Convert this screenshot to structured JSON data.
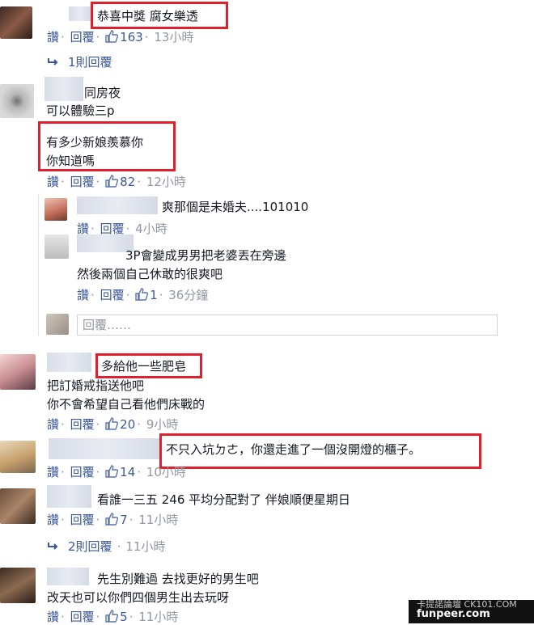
{
  "comments": [
    {
      "text1": "恭喜中獎 腐女樂透",
      "actions": {
        "like": "讚",
        "reply": "回覆",
        "likes": "163",
        "time": "13小時"
      }
    },
    {
      "more": "1則回覆"
    },
    {
      "text1": "同房夜",
      "text2": "可以體驗三p",
      "text3": "有多少新娘羨慕你",
      "text4": "你知道嗎",
      "actions": {
        "like": "讚",
        "reply": "回覆",
        "likes": "82",
        "time": "12小時"
      }
    },
    {
      "text1": "爽那個是未婚夫....101010",
      "actions": {
        "like": "讚",
        "reply": "回覆",
        "time": "4小時"
      }
    },
    {
      "text1": "3P會變成男男把老婆丟在旁邊",
      "text2": "然後兩個自己休敢的很爽吧",
      "actions": {
        "like": "讚",
        "reply": "回覆",
        "likes": "1",
        "time": "36分鐘"
      }
    },
    {
      "reply_placeholder": "回覆……"
    },
    {
      "text1": "多給他一些肥皂",
      "text2": "把訂婚戒指送他吧",
      "text3": "你不會希望自己看他們床戰的",
      "actions": {
        "like": "讚",
        "reply": "回覆",
        "likes": "20",
        "time": "9小時"
      }
    },
    {
      "text1": "不只入坑ㄉㄜ，你還走進了一個沒開燈的櫃子。",
      "actions": {
        "like": "讚",
        "reply": "回覆",
        "likes": "14",
        "time": "10小時"
      }
    },
    {
      "text1": "看誰一三五 246 平均分配對了 伴娘順便星期日",
      "actions": {
        "like": "讚",
        "reply": "回覆",
        "likes": "7",
        "time": "11小時"
      }
    },
    {
      "more": "2則回覆",
      "time": "11小時"
    },
    {
      "text1": "先生別難過 去找更好的男生吧",
      "text2": "改天也可以你們四個男生出去玩呀",
      "actions": {
        "like": "讚",
        "reply": "回覆",
        "likes": "5",
        "time": "11小時"
      }
    }
  ],
  "footer": {
    "site": "funpeer.com",
    "watermark": "卡提諾論壇 CK101.COM"
  },
  "colors": {
    "link": "#3b5998",
    "highlight_box": "#e0202e"
  }
}
